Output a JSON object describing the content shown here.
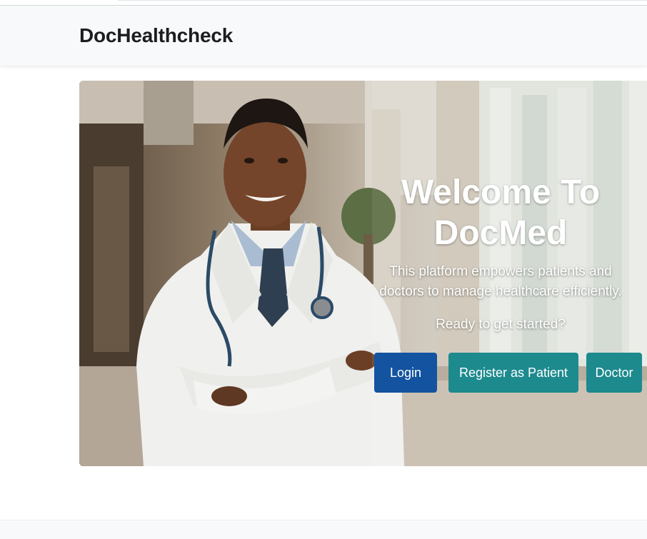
{
  "navbar": {
    "brand": "DocHealthcheck"
  },
  "hero": {
    "title_line1": "Welcome To",
    "title_line2": "DocMed",
    "subtitle_line1": "This platform empowers patients and",
    "subtitle_line2": "doctors to manage healthcare efficiently.",
    "prompt": "Ready to get started?"
  },
  "buttons": {
    "login": "Login",
    "register_patient": "Register as Patient",
    "doctor": "Doctor"
  },
  "colors": {
    "login_button": "#14539f",
    "secondary_button": "#1d8a8e",
    "navbar_bg": "#f8f9fa"
  },
  "icons": {
    "hero_image": "smiling-doctor-with-stethoscope-photo"
  }
}
